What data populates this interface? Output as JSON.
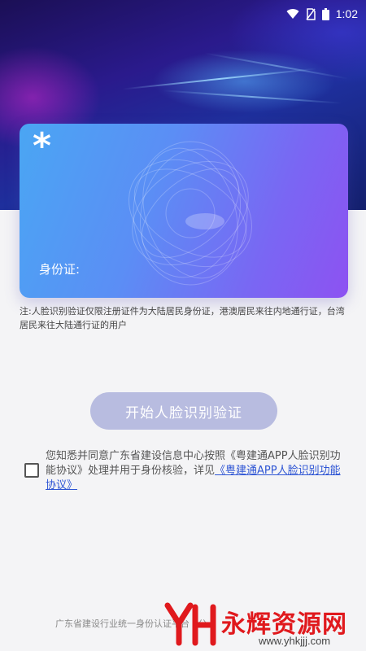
{
  "status_bar": {
    "time": "1:02",
    "icons": [
      "wifi-icon",
      "no-sim-icon",
      "battery-icon"
    ]
  },
  "card": {
    "symbol": "*",
    "id_label": "身份证:"
  },
  "note": {
    "text": "注:人脸识别验证仅限注册证件为大陆居民身份证，港澳居民来往内地通行证，台湾居民来往大陆通行证的用户"
  },
  "start_button": {
    "label": "开始人脸识别验证"
  },
  "agreement": {
    "text_before": "您知悉并同意广东省建设信息中心按照",
    "link1": "《粤建通APP人脸识别功能协议》",
    "text_middle": "处理并用于身份核验，详见",
    "link2": "《粤建通APP人脸识别功能协议》"
  },
  "footer": {
    "text": "广东省建设行业统一身份认证平台 · 公"
  },
  "watermark": {
    "logo_letters": "YH",
    "text": "永辉资源网",
    "url": "www.yhkjjj.com"
  },
  "colors": {
    "card_start": "#4aa6f3",
    "card_end": "#8d52f2",
    "button_disabled": "#b8bce0",
    "link": "#2e55d4",
    "watermark_red": "#e0191d"
  }
}
